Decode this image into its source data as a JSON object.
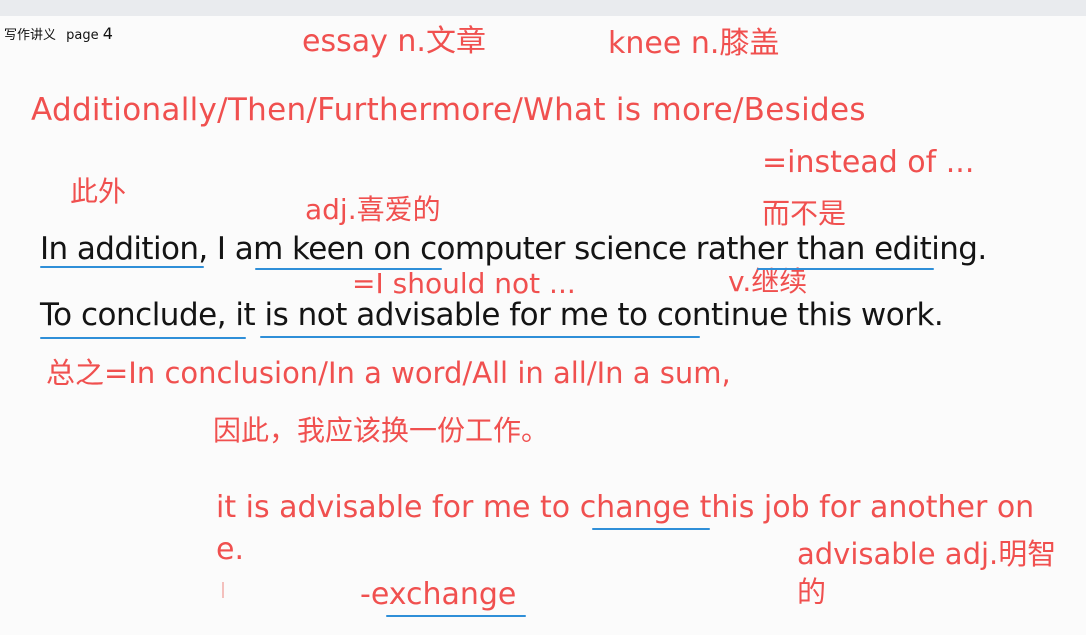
{
  "page_label": {
    "text": "写作讲义",
    "page_word": "page",
    "page_num": "4"
  },
  "notes": {
    "essay": "essay n.文章",
    "knee": "knee n.膝盖",
    "additionally": "Additionally/Then/Furthermore/What is more/Besides",
    "ciwai": "此外",
    "adj_xiai": "adj.喜爱的",
    "instead_of": "=instead of ...",
    "erbushi": "而不是",
    "i_should_not": "=I should not ...",
    "v_jixu": "v.继续",
    "zongzhi": "总之=In conclusion/In a word/All in all/In a sum,",
    "yinci": "因此，我应该换一份工作。",
    "advisable_line_1": "it is advisable for me to change this job for another on",
    "advisable_line_2": "e.",
    "advisable_adj_1": "advisable adj.明智",
    "advisable_adj_2": "的",
    "exchange": "-exchange"
  },
  "sentences": {
    "s1": "In addition, I am keen on computer science rather than editing.",
    "s2": "To conclude, it is not advisable for me to continue this work."
  }
}
